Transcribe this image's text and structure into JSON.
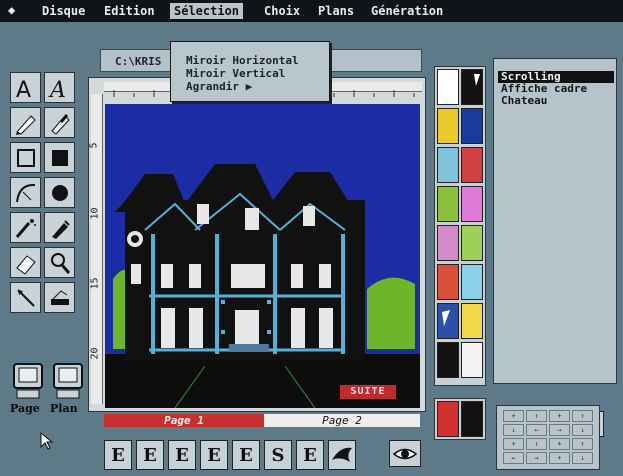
{
  "menubar": {
    "items": [
      "Disque",
      "Edition",
      "Sélection",
      "Choix",
      "Plans",
      "Génération"
    ],
    "active_index": 2,
    "arrows_icon": "left-right-arrows-icon"
  },
  "dropdown": {
    "items": [
      "Miroir Horizontal",
      "Miroir Vertical",
      "Agrandir"
    ]
  },
  "path_field": {
    "value": "C:\\KRIS"
  },
  "canvas": {
    "suite_label": "SUITE",
    "ruler_left_numbers": [
      "5",
      "10",
      "15",
      "20"
    ]
  },
  "page_tabs": {
    "page1": "Page 1",
    "page2": "Page 2"
  },
  "tools": {
    "page_label": "Page",
    "plan_label": "Plan"
  },
  "list": {
    "items": [
      "Scrolling",
      "Affiche cadre",
      "Chateau"
    ],
    "selected_index": 0
  },
  "palette": {
    "left_colors": [
      "#ffffff",
      "#e8c92c",
      "#7fc2da",
      "#8cbf3a",
      "#d38ac9",
      "#d8503a",
      "#2c4fa8",
      "#111111"
    ],
    "right_colors": [
      "#121212",
      "#1b3aa0",
      "#d04040",
      "#e07ad8",
      "#9ed056",
      "#8bd0e8",
      "#f0d84a",
      "#f2f2f2"
    ],
    "bottom_colors": [
      "#d03030",
      "#111111"
    ]
  },
  "grid_symbols": [
    "+",
    "↑",
    "+",
    "↑",
    "↓",
    "←",
    "→",
    "↓",
    "+",
    "↑",
    "+",
    "↑",
    "←",
    "→",
    "+",
    "↓"
  ],
  "bottom_icons": [
    "E",
    "E",
    "E",
    "E",
    "E",
    "S",
    "E"
  ]
}
